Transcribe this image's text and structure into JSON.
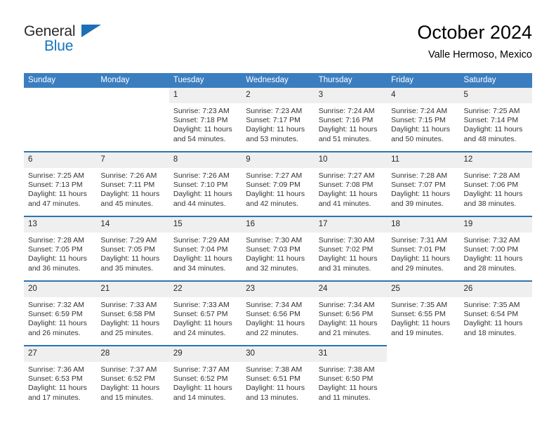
{
  "brand": {
    "name_top": "General",
    "name_bottom": "Blue",
    "color_top": "#2b2b2b",
    "color_bottom": "#1574bd",
    "accent": "#1b6fb5"
  },
  "header": {
    "title": "October 2024",
    "subtitle": "Valle Hermoso, Mexico"
  },
  "theme": {
    "header_blue": "#3b7ec0",
    "row_line_blue": "#2c74b3",
    "daynum_gray": "#efefef",
    "cell_white": "#ffffff"
  },
  "calendar": {
    "weekday_headers": [
      "Sunday",
      "Monday",
      "Tuesday",
      "Wednesday",
      "Thursday",
      "Friday",
      "Saturday"
    ],
    "labels": {
      "sunrise": "Sunrise:",
      "sunset": "Sunset:",
      "daylight": "Daylight:"
    },
    "weeks": [
      [
        {
          "day": "",
          "blank": true
        },
        {
          "day": "",
          "blank": true
        },
        {
          "day": "1",
          "sunrise": "Sunrise: 7:23 AM",
          "sunset": "Sunset: 7:18 PM",
          "daylight_1": "Daylight: 11 hours",
          "daylight_2": "and 54 minutes."
        },
        {
          "day": "2",
          "sunrise": "Sunrise: 7:23 AM",
          "sunset": "Sunset: 7:17 PM",
          "daylight_1": "Daylight: 11 hours",
          "daylight_2": "and 53 minutes."
        },
        {
          "day": "3",
          "sunrise": "Sunrise: 7:24 AM",
          "sunset": "Sunset: 7:16 PM",
          "daylight_1": "Daylight: 11 hours",
          "daylight_2": "and 51 minutes."
        },
        {
          "day": "4",
          "sunrise": "Sunrise: 7:24 AM",
          "sunset": "Sunset: 7:15 PM",
          "daylight_1": "Daylight: 11 hours",
          "daylight_2": "and 50 minutes."
        },
        {
          "day": "5",
          "sunrise": "Sunrise: 7:25 AM",
          "sunset": "Sunset: 7:14 PM",
          "daylight_1": "Daylight: 11 hours",
          "daylight_2": "and 48 minutes."
        }
      ],
      [
        {
          "day": "6",
          "sunrise": "Sunrise: 7:25 AM",
          "sunset": "Sunset: 7:13 PM",
          "daylight_1": "Daylight: 11 hours",
          "daylight_2": "and 47 minutes."
        },
        {
          "day": "7",
          "sunrise": "Sunrise: 7:26 AM",
          "sunset": "Sunset: 7:11 PM",
          "daylight_1": "Daylight: 11 hours",
          "daylight_2": "and 45 minutes."
        },
        {
          "day": "8",
          "sunrise": "Sunrise: 7:26 AM",
          "sunset": "Sunset: 7:10 PM",
          "daylight_1": "Daylight: 11 hours",
          "daylight_2": "and 44 minutes."
        },
        {
          "day": "9",
          "sunrise": "Sunrise: 7:27 AM",
          "sunset": "Sunset: 7:09 PM",
          "daylight_1": "Daylight: 11 hours",
          "daylight_2": "and 42 minutes."
        },
        {
          "day": "10",
          "sunrise": "Sunrise: 7:27 AM",
          "sunset": "Sunset: 7:08 PM",
          "daylight_1": "Daylight: 11 hours",
          "daylight_2": "and 41 minutes."
        },
        {
          "day": "11",
          "sunrise": "Sunrise: 7:28 AM",
          "sunset": "Sunset: 7:07 PM",
          "daylight_1": "Daylight: 11 hours",
          "daylight_2": "and 39 minutes."
        },
        {
          "day": "12",
          "sunrise": "Sunrise: 7:28 AM",
          "sunset": "Sunset: 7:06 PM",
          "daylight_1": "Daylight: 11 hours",
          "daylight_2": "and 38 minutes."
        }
      ],
      [
        {
          "day": "13",
          "sunrise": "Sunrise: 7:28 AM",
          "sunset": "Sunset: 7:05 PM",
          "daylight_1": "Daylight: 11 hours",
          "daylight_2": "and 36 minutes."
        },
        {
          "day": "14",
          "sunrise": "Sunrise: 7:29 AM",
          "sunset": "Sunset: 7:05 PM",
          "daylight_1": "Daylight: 11 hours",
          "daylight_2": "and 35 minutes."
        },
        {
          "day": "15",
          "sunrise": "Sunrise: 7:29 AM",
          "sunset": "Sunset: 7:04 PM",
          "daylight_1": "Daylight: 11 hours",
          "daylight_2": "and 34 minutes."
        },
        {
          "day": "16",
          "sunrise": "Sunrise: 7:30 AM",
          "sunset": "Sunset: 7:03 PM",
          "daylight_1": "Daylight: 11 hours",
          "daylight_2": "and 32 minutes."
        },
        {
          "day": "17",
          "sunrise": "Sunrise: 7:30 AM",
          "sunset": "Sunset: 7:02 PM",
          "daylight_1": "Daylight: 11 hours",
          "daylight_2": "and 31 minutes."
        },
        {
          "day": "18",
          "sunrise": "Sunrise: 7:31 AM",
          "sunset": "Sunset: 7:01 PM",
          "daylight_1": "Daylight: 11 hours",
          "daylight_2": "and 29 minutes."
        },
        {
          "day": "19",
          "sunrise": "Sunrise: 7:32 AM",
          "sunset": "Sunset: 7:00 PM",
          "daylight_1": "Daylight: 11 hours",
          "daylight_2": "and 28 minutes."
        }
      ],
      [
        {
          "day": "20",
          "sunrise": "Sunrise: 7:32 AM",
          "sunset": "Sunset: 6:59 PM",
          "daylight_1": "Daylight: 11 hours",
          "daylight_2": "and 26 minutes."
        },
        {
          "day": "21",
          "sunrise": "Sunrise: 7:33 AM",
          "sunset": "Sunset: 6:58 PM",
          "daylight_1": "Daylight: 11 hours",
          "daylight_2": "and 25 minutes."
        },
        {
          "day": "22",
          "sunrise": "Sunrise: 7:33 AM",
          "sunset": "Sunset: 6:57 PM",
          "daylight_1": "Daylight: 11 hours",
          "daylight_2": "and 24 minutes."
        },
        {
          "day": "23",
          "sunrise": "Sunrise: 7:34 AM",
          "sunset": "Sunset: 6:56 PM",
          "daylight_1": "Daylight: 11 hours",
          "daylight_2": "and 22 minutes."
        },
        {
          "day": "24",
          "sunrise": "Sunrise: 7:34 AM",
          "sunset": "Sunset: 6:56 PM",
          "daylight_1": "Daylight: 11 hours",
          "daylight_2": "and 21 minutes."
        },
        {
          "day": "25",
          "sunrise": "Sunrise: 7:35 AM",
          "sunset": "Sunset: 6:55 PM",
          "daylight_1": "Daylight: 11 hours",
          "daylight_2": "and 19 minutes."
        },
        {
          "day": "26",
          "sunrise": "Sunrise: 7:35 AM",
          "sunset": "Sunset: 6:54 PM",
          "daylight_1": "Daylight: 11 hours",
          "daylight_2": "and 18 minutes."
        }
      ],
      [
        {
          "day": "27",
          "sunrise": "Sunrise: 7:36 AM",
          "sunset": "Sunset: 6:53 PM",
          "daylight_1": "Daylight: 11 hours",
          "daylight_2": "and 17 minutes."
        },
        {
          "day": "28",
          "sunrise": "Sunrise: 7:37 AM",
          "sunset": "Sunset: 6:52 PM",
          "daylight_1": "Daylight: 11 hours",
          "daylight_2": "and 15 minutes."
        },
        {
          "day": "29",
          "sunrise": "Sunrise: 7:37 AM",
          "sunset": "Sunset: 6:52 PM",
          "daylight_1": "Daylight: 11 hours",
          "daylight_2": "and 14 minutes."
        },
        {
          "day": "30",
          "sunrise": "Sunrise: 7:38 AM",
          "sunset": "Sunset: 6:51 PM",
          "daylight_1": "Daylight: 11 hours",
          "daylight_2": "and 13 minutes."
        },
        {
          "day": "31",
          "sunrise": "Sunrise: 7:38 AM",
          "sunset": "Sunset: 6:50 PM",
          "daylight_1": "Daylight: 11 hours",
          "daylight_2": "and 11 minutes."
        },
        {
          "day": "",
          "blank": true
        },
        {
          "day": "",
          "blank": true
        }
      ]
    ]
  }
}
